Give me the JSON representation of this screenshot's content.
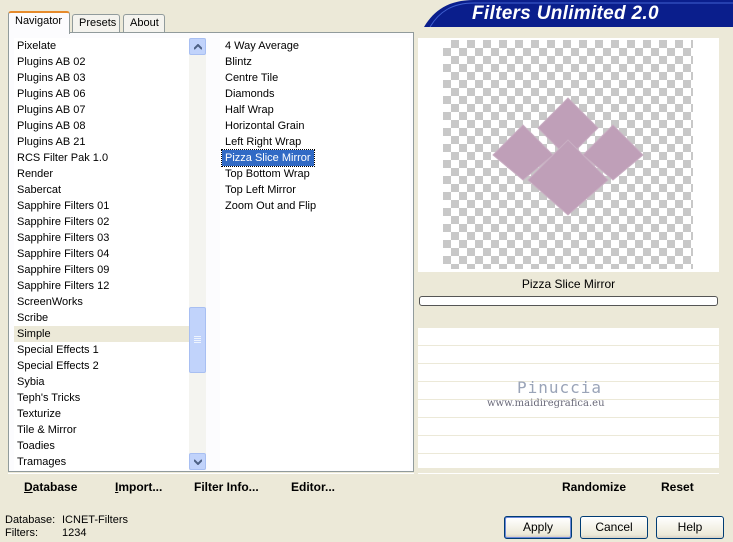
{
  "tabs": [
    {
      "label": "Navigator",
      "active": true
    },
    {
      "label": "Presets",
      "active": false
    },
    {
      "label": "About",
      "active": false
    }
  ],
  "banner": {
    "title": "Filters Unlimited 2.0",
    "color": "#0a1e8c"
  },
  "categories": {
    "items": [
      "Pixelate",
      "Plugins AB 02",
      "Plugins AB 03",
      "Plugins AB 06",
      "Plugins AB 07",
      "Plugins AB 08",
      "Plugins AB 21",
      "RCS Filter Pak 1.0",
      "Render",
      "Sabercat",
      "Sapphire Filters 01",
      "Sapphire Filters 02",
      "Sapphire Filters 03",
      "Sapphire Filters 04",
      "Sapphire Filters 09",
      "Sapphire Filters 12",
      "ScreenWorks",
      "Scribe",
      "Simple",
      "Special Effects 1",
      "Special Effects 2",
      "Sybia",
      "Teph's Tricks",
      "Texturize",
      "Tile & Mirror",
      "Toadies",
      "Tramages"
    ],
    "highlighted": "Simple",
    "scroll_position": 0.76
  },
  "filters": {
    "items": [
      "4 Way Average",
      "Blintz",
      "Centre Tile",
      "Diamonds",
      "Half Wrap",
      "Horizontal Grain",
      "Left Right Wrap",
      "Pizza Slice Mirror",
      "Top Bottom Wrap",
      "Top Left Mirror",
      "Zoom Out and Flip"
    ],
    "selected": "Pizza Slice Mirror"
  },
  "preview": {
    "filter_name": "Pizza Slice Mirror",
    "progress": 0,
    "shape_color": "#bf9fb8"
  },
  "watermark": {
    "name": "Pinuccia",
    "url": "www.maidiregrafica.eu"
  },
  "toolbar_left": [
    {
      "label": "Database",
      "underline": "D",
      "rest": "atabase"
    },
    {
      "label": "Import...",
      "underline": "I",
      "rest": "mport..."
    },
    {
      "label": "Filter Info...",
      "underline": "Filter Info",
      "rest": "..."
    },
    {
      "label": "Editor...",
      "underline": "Editor",
      "rest": "..."
    }
  ],
  "toolbar_right": {
    "randomize": "Randomize",
    "reset": "Reset"
  },
  "status": {
    "database_label": "Database:",
    "database_value": "ICNET-Filters",
    "filters_label": "Filters:",
    "filters_value": "1234"
  },
  "dialog": {
    "apply": "Apply",
    "cancel": "Cancel",
    "help": "Help"
  }
}
